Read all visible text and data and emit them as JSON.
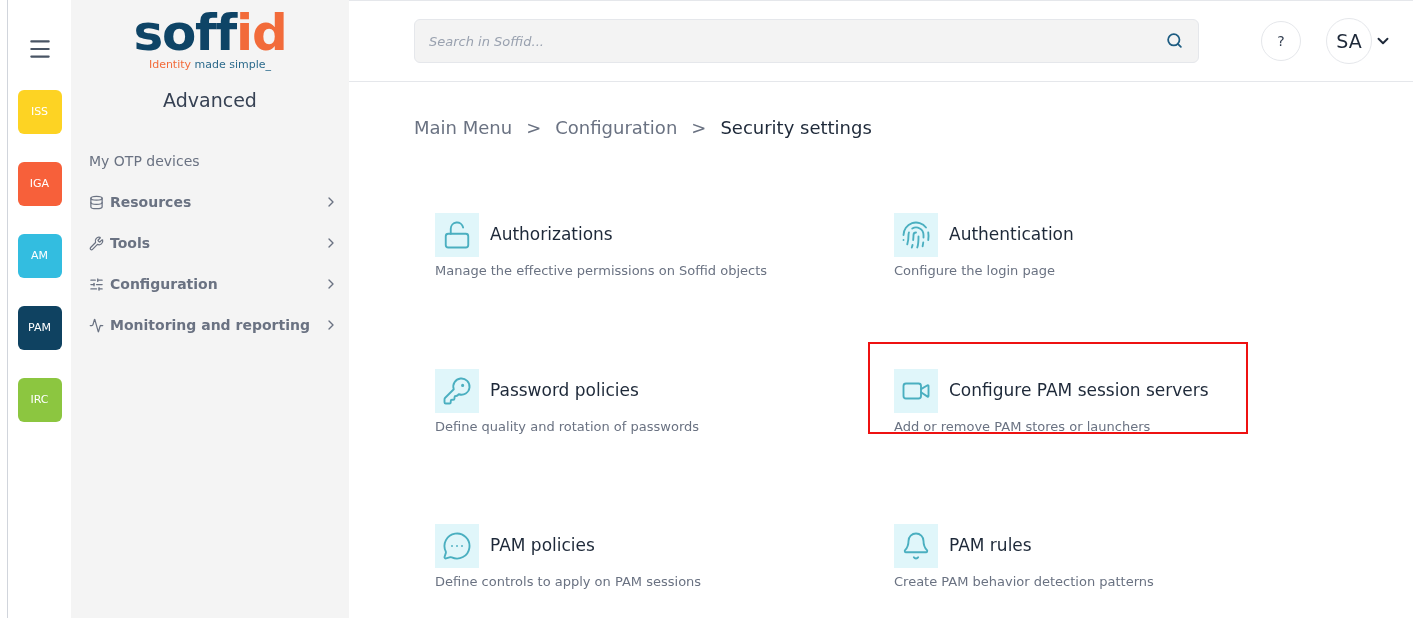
{
  "logo": {
    "parts": [
      {
        "text": "soff",
        "color": "#0e4466"
      },
      {
        "text": "id",
        "color": "#f26b3a"
      }
    ],
    "tagline": [
      {
        "text": "Identity",
        "color": "#f26b3a"
      },
      {
        "text": " made simple_",
        "color": "#2b6a8c"
      }
    ]
  },
  "apps": [
    {
      "label": "ISS",
      "color": "#fdd323"
    },
    {
      "label": "IGA",
      "color": "#f7603a"
    },
    {
      "label": "AM",
      "color": "#33bde0"
    },
    {
      "label": "PAM",
      "color": "#0f4261"
    },
    {
      "label": "IRC",
      "color": "#8cc640"
    }
  ],
  "sidebar": {
    "title": "Advanced",
    "items": [
      {
        "label": "My OTP devices",
        "kind": "plain",
        "has_submenu": false
      },
      {
        "label": "Resources",
        "kind": "database",
        "has_submenu": true
      },
      {
        "label": "Tools",
        "kind": "wrench",
        "has_submenu": true
      },
      {
        "label": "Configuration",
        "kind": "sliders",
        "has_submenu": true
      },
      {
        "label": "Monitoring and reporting",
        "kind": "chart",
        "has_submenu": true
      }
    ]
  },
  "search": {
    "placeholder": "Search in Soffid..."
  },
  "help": "?",
  "user": "SA",
  "breadcrumb": [
    {
      "label": "Main Menu",
      "current": false
    },
    {
      "label": ">",
      "current": false
    },
    {
      "label": "Configuration",
      "current": false
    },
    {
      "label": ">",
      "current": false
    },
    {
      "label": "Security settings",
      "current": true
    }
  ],
  "cards": [
    {
      "kind": "lock",
      "title": "Authorizations",
      "description": "Manage the effective permissions on Soffid objects",
      "highlighted": false
    },
    {
      "kind": "fingerprint",
      "title": "Authentication",
      "description": "Configure the login page",
      "highlighted": false
    },
    {
      "kind": "key",
      "title": "Password policies",
      "description": "Define quality and rotation of passwords",
      "highlighted": false
    },
    {
      "kind": "video",
      "title": "Configure PAM session servers",
      "description": "Add or remove PAM stores or launchers",
      "highlighted": true
    },
    {
      "kind": "chat",
      "title": "PAM policies",
      "description": "Define controls to apply on PAM sessions",
      "highlighted": false
    },
    {
      "kind": "bell",
      "title": "PAM rules",
      "description": "Create PAM behavior detection patterns",
      "highlighted": false
    }
  ]
}
